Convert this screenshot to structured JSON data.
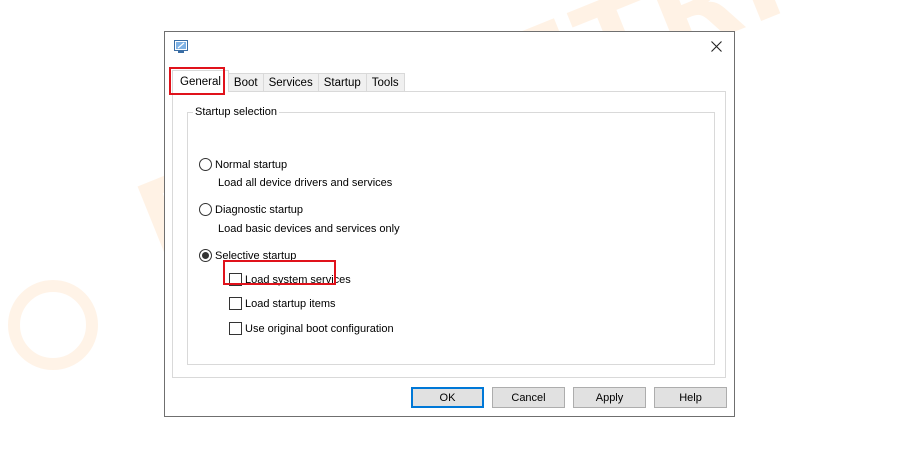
{
  "tabs": [
    "General",
    "Boot",
    "Services",
    "Startup",
    "Tools"
  ],
  "group_title": "Startup selection",
  "options": {
    "normal": {
      "label": "Normal startup",
      "desc": "Load all device drivers and services"
    },
    "diagnostic": {
      "label": "Diagnostic startup",
      "desc": "Load basic devices and services only"
    },
    "selective": {
      "label": "Selective startup"
    }
  },
  "selective_items": {
    "system_services": "Load system services",
    "startup_items": "Load startup items",
    "original_boot": "Use original boot configuration"
  },
  "buttons": {
    "ok": "OK",
    "cancel": "Cancel",
    "apply": "Apply",
    "help": "Help"
  },
  "selected_option": "selective",
  "colors": {
    "highlight": "#e0121b",
    "default_button": "#0078d7"
  },
  "icons": {
    "app": "msconfig-icon",
    "close": "close-icon"
  }
}
